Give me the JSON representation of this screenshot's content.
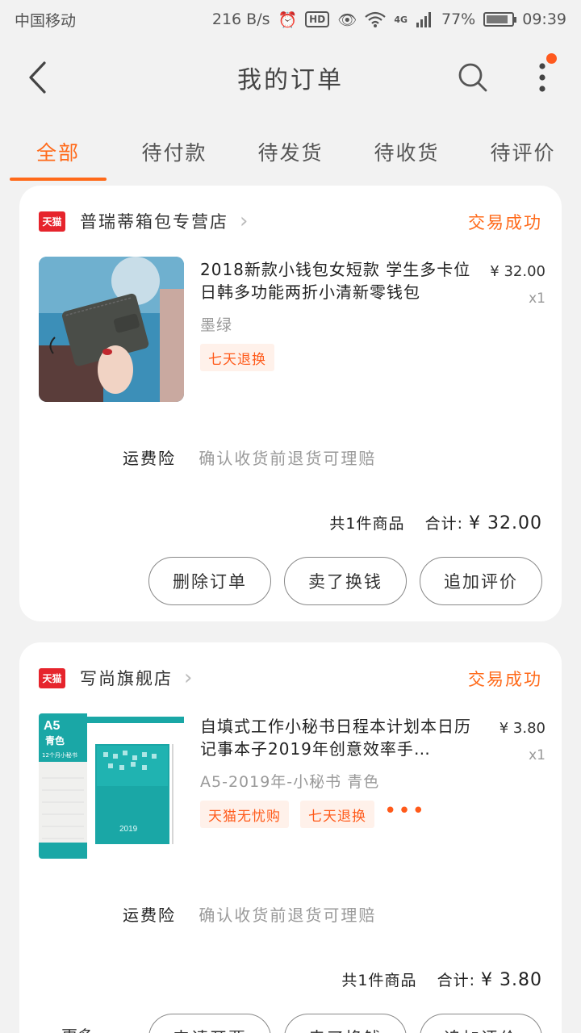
{
  "status_bar": {
    "carrier": "中国移动",
    "speed": "216 B/s",
    "hd": "HD",
    "network": "4G",
    "battery": "77%",
    "time": "09:39"
  },
  "header": {
    "title": "我的订单"
  },
  "tabs": [
    {
      "label": "全部"
    },
    {
      "label": "待付款"
    },
    {
      "label": "待发货"
    },
    {
      "label": "待收货"
    },
    {
      "label": "待评价"
    }
  ],
  "orders": [
    {
      "badge": "天猫",
      "shop": "普瑞蒂箱包专营店",
      "status": "交易成功",
      "title": "2018新款小钱包女短款 学生多卡位日韩多功能两折小清新零钱包",
      "price": "¥ 32.00",
      "qty": "x1",
      "sku": "墨绿",
      "tags": [
        "七天退换"
      ],
      "insurance_label": "运费险",
      "insurance_text": "确认收货前退货可理赔",
      "count_text": "共1件商品",
      "total_label": "合计:",
      "total": "¥ 32.00",
      "buttons": [
        "删除订单",
        "卖了换钱",
        "追加评价"
      ]
    },
    {
      "badge": "天猫",
      "shop": "写尚旗舰店",
      "status": "交易成功",
      "title": "自填式工作小秘书日程本计划本日历记事本子2019年创意效率手…",
      "price": "¥ 3.80",
      "qty": "x1",
      "sku": "A5-2019年-小秘书  青色",
      "tags": [
        "天猫无忧购",
        "七天退换"
      ],
      "tags_more": "•••",
      "insurance_label": "运费险",
      "insurance_text": "确认收货前退货可理赔",
      "count_text": "共1件商品",
      "total_label": "合计:",
      "total": "¥ 3.80",
      "more_label": "更多",
      "buttons": [
        "申请开票",
        "卖了换钱",
        "追加评价"
      ],
      "thumb_text": {
        "size": "A5",
        "color": "青色",
        "caption": "12个月小秘书",
        "year": "2019"
      }
    }
  ],
  "colors": {
    "accent": "#ff6a1a",
    "tmall_red": "#e6242c",
    "background": "#f2f2f2"
  }
}
